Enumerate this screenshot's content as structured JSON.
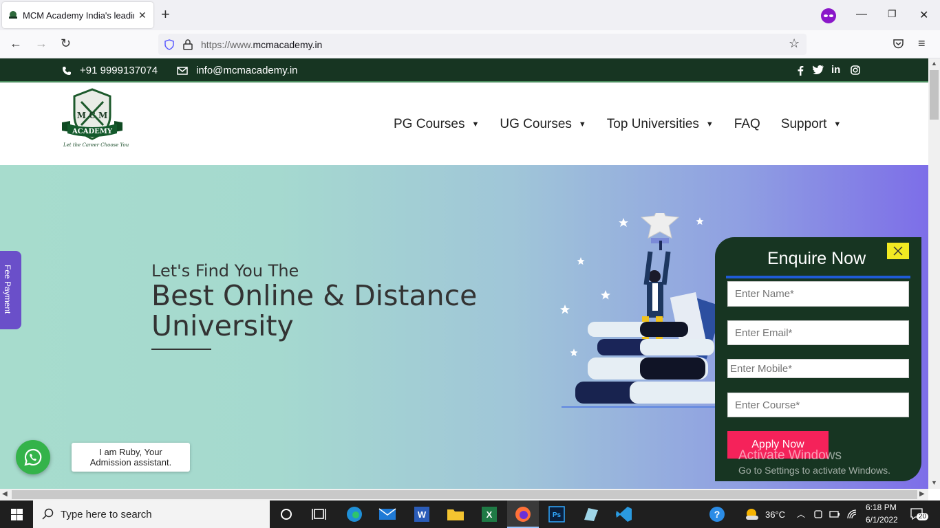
{
  "browser": {
    "tab_title": "MCM Academy India's leading",
    "url_scheme": "https://www.",
    "url_host": "mcmacademy.in"
  },
  "topbar": {
    "phone": "+91 9999137074",
    "email": "info@mcmacademy.in"
  },
  "logo": {
    "letters": "M C M",
    "banner": "ACADEMY",
    "tagline": "Let the Career Choose You"
  },
  "menu": [
    {
      "label": "PG Courses",
      "dropdown": true
    },
    {
      "label": "UG Courses",
      "dropdown": true
    },
    {
      "label": "Top Universities",
      "dropdown": true
    },
    {
      "label": "FAQ",
      "dropdown": false
    },
    {
      "label": "Support",
      "dropdown": true
    }
  ],
  "hero": {
    "subtitle": "Let's Find You The",
    "title": "Best Online & Distance University"
  },
  "fee_tab": "Fee Payment",
  "chat": {
    "bubble_line1": "I am Ruby, Your",
    "bubble_line2": "Admission assistant."
  },
  "enquiry": {
    "title": "Enquire Now",
    "name_placeholder": "Enter Name*",
    "email_placeholder": "Enter Email*",
    "mobile_placeholder": "Enter Mobile*",
    "course_placeholder": "Enter Course*",
    "submit_label": "Apply Now"
  },
  "watermark": {
    "line1": "Activate Windows",
    "line2": "Go to Settings to activate Windows."
  },
  "taskbar": {
    "search_placeholder": "Type here to search",
    "temperature": "36°C",
    "time": "6:18 PM",
    "date": "6/1/2022",
    "notifications": "20"
  },
  "colors": {
    "topbar": "#173522",
    "accent_button": "#f5225a",
    "close_button": "#f2ea22",
    "fee_tab": "#6a4fc9"
  }
}
